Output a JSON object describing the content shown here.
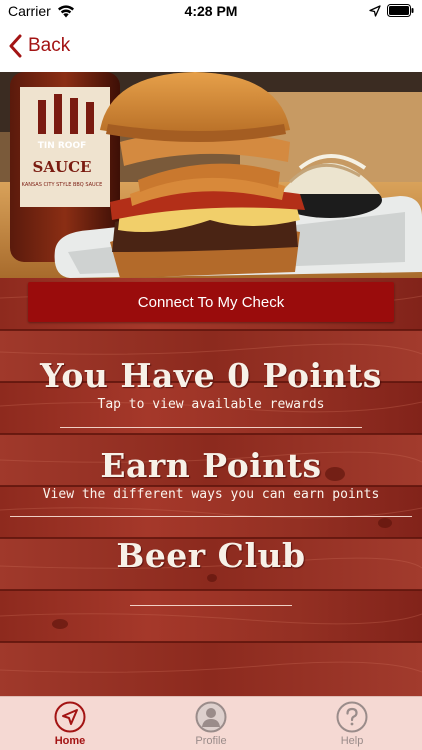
{
  "status_bar": {
    "carrier": "Carrier",
    "time": "4:28 PM"
  },
  "nav": {
    "back_label": "Back"
  },
  "hero": {
    "bottle_brand": "TIN ROOF",
    "bottle_label": "SAUCE",
    "bottle_subtext": "KANSAS CITY STYLE BBQ SAUCE"
  },
  "connect_label": "Connect To My Check",
  "menu": [
    {
      "title": "You Have 0 Points",
      "subtitle": "Tap to view available rewards"
    },
    {
      "title": "Earn Points",
      "subtitle": "View the different ways you can earn points"
    },
    {
      "title": "Beer Club",
      "subtitle": ""
    }
  ],
  "tabs": [
    {
      "label": "Home",
      "icon": "navigation-arrow-icon",
      "active": true
    },
    {
      "label": "Profile",
      "icon": "person-icon",
      "active": false
    },
    {
      "label": "Help",
      "icon": "question-mark-icon",
      "active": false
    }
  ],
  "colors": {
    "brand_red": "#a31414",
    "button_red": "#9a0c0c",
    "tab_bar_bg": "#f5d9d3"
  }
}
